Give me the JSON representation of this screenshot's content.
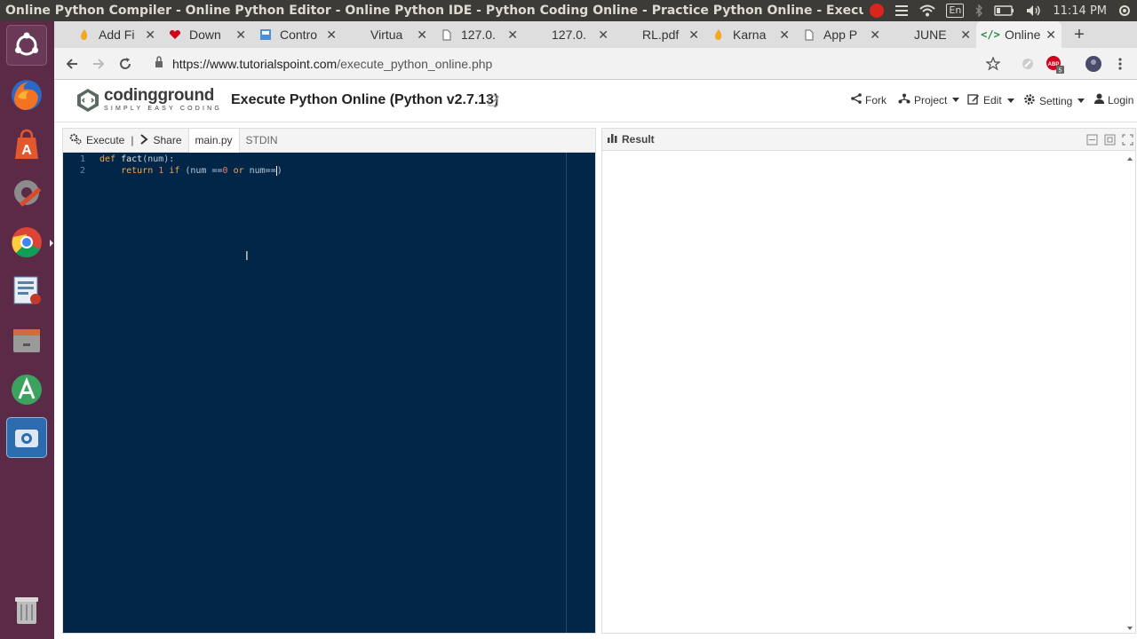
{
  "os": {
    "window_title": "Online Python Compiler - Online Python Editor - Online Python IDE - Python Coding Online - Practice Python Online - Execute Python Online - C",
    "input_indicator": "En",
    "clock": "11:14 PM"
  },
  "launcher": {
    "items": [
      "ubuntu-dash-icon",
      "firefox-icon",
      "software-center-icon",
      "system-settings-icon",
      "chrome-icon",
      "document-viewer-icon",
      "files-icon",
      "android-studio-icon",
      "screenshot-tool-icon",
      "trash-icon"
    ]
  },
  "browser": {
    "tabs": [
      {
        "label": "Add Fi",
        "icon": "flame-icon"
      },
      {
        "label": "Down",
        "icon": "heart-icon"
      },
      {
        "label": "Contro",
        "icon": "control-panel-icon"
      },
      {
        "label": "Virtua",
        "icon": "blank-page-icon"
      },
      {
        "label": "127.0.",
        "icon": "page-icon"
      },
      {
        "label": "127.0.",
        "icon": "blank-page-icon"
      },
      {
        "label": "RL.pdf",
        "icon": "blank-page-icon"
      },
      {
        "label": "Karna",
        "icon": "flame-icon"
      },
      {
        "label": "App P",
        "icon": "page-icon"
      },
      {
        "label": "JUNE",
        "icon": "blank-page-icon"
      },
      {
        "label": "Online",
        "icon": "code-icon"
      }
    ],
    "active_tab_index": 10,
    "url_host": "https://www.tutorialspoint.com",
    "url_path": "/execute_python_online.php",
    "extension_badge": "5"
  },
  "site": {
    "logo_name": "codingground",
    "logo_tagline": "SIMPLY EASY CODING",
    "title": "Execute Python Online (Python v2.7.13)",
    "menu": [
      {
        "label": "Fork",
        "icon": "fork-icon",
        "dropdown": false
      },
      {
        "label": "Project",
        "icon": "project-icon",
        "dropdown": true
      },
      {
        "label": "Edit",
        "icon": "edit-icon",
        "dropdown": true
      },
      {
        "label": "Setting",
        "icon": "gear-icon",
        "dropdown": true
      },
      {
        "label": "Login",
        "icon": "user-icon",
        "dropdown": false
      }
    ]
  },
  "editor": {
    "execute_label": "Execute",
    "share_label": "Share",
    "file_tab": "main.py",
    "stdin_tab": "STDIN",
    "lines": [
      {
        "num": "1",
        "code": "def fact(num):"
      },
      {
        "num": "2",
        "code": "    return 1 if (num ==0 or num==)"
      }
    ]
  },
  "result": {
    "title": "Result"
  },
  "colors": {
    "launcher_bg": "#5a2a47",
    "editor_bg": "#022648",
    "keyword": "#f0a848",
    "number": "#f08060"
  }
}
